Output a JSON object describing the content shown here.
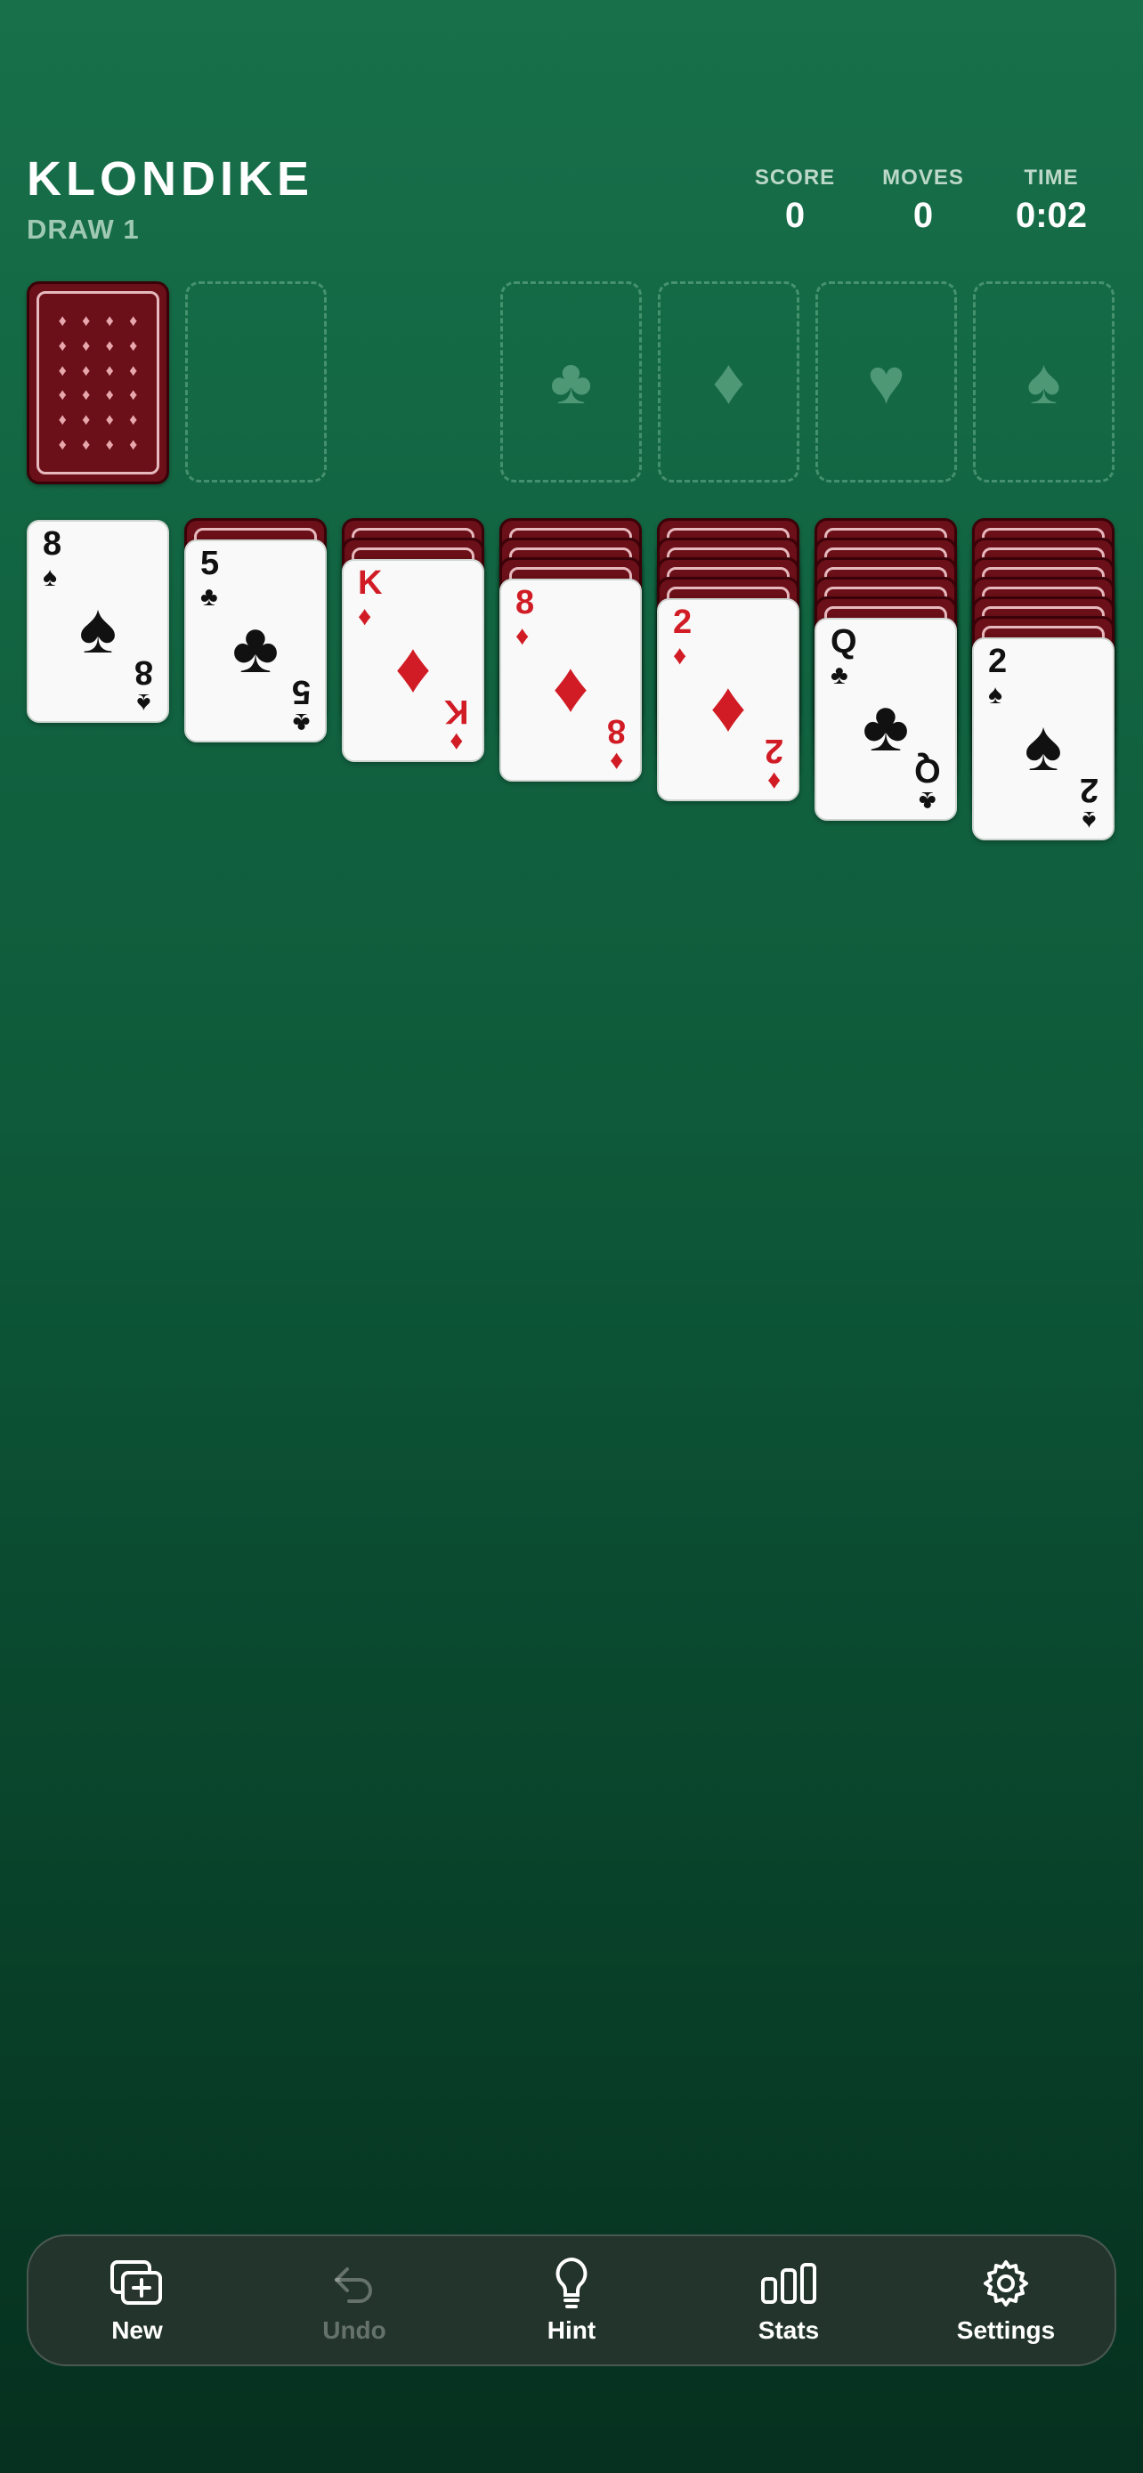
{
  "header": {
    "title": "KLONDIKE",
    "subtitle": "DRAW 1"
  },
  "stats": [
    {
      "label": "SCORE",
      "value": "0"
    },
    {
      "label": "MOVES",
      "value": "0"
    },
    {
      "label": "TIME",
      "value": "0:02"
    }
  ],
  "foundations": [
    {
      "suit": "♣",
      "icon": "club-icon"
    },
    {
      "suit": "♦",
      "icon": "diamond-icon"
    },
    {
      "suit": "♥",
      "icon": "heart-icon"
    },
    {
      "suit": "♠",
      "icon": "spade-icon"
    }
  ],
  "tableau": [
    {
      "hidden": 0,
      "rank": "8",
      "suit": "♠",
      "color": "black"
    },
    {
      "hidden": 1,
      "rank": "5",
      "suit": "♣",
      "color": "black"
    },
    {
      "hidden": 2,
      "rank": "K",
      "suit": "♦",
      "color": "red"
    },
    {
      "hidden": 3,
      "rank": "8",
      "suit": "♦",
      "color": "red"
    },
    {
      "hidden": 4,
      "rank": "2",
      "suit": "♦",
      "color": "red"
    },
    {
      "hidden": 5,
      "rank": "Q",
      "suit": "♣",
      "color": "black"
    },
    {
      "hidden": 6,
      "rank": "2",
      "suit": "♠",
      "color": "black"
    }
  ],
  "toolbar": [
    {
      "label": "New",
      "icon": "new-game-icon",
      "enabled": true
    },
    {
      "label": "Undo",
      "icon": "undo-icon",
      "enabled": false
    },
    {
      "label": "Hint",
      "icon": "lightbulb-icon",
      "enabled": true
    },
    {
      "label": "Stats",
      "icon": "bar-chart-icon",
      "enabled": true
    },
    {
      "label": "Settings",
      "icon": "gear-icon",
      "enabled": true
    }
  ],
  "colors": {
    "card_back": "#6b0f18",
    "red_suit": "#d11c25",
    "felt": "#0e5a3a"
  }
}
